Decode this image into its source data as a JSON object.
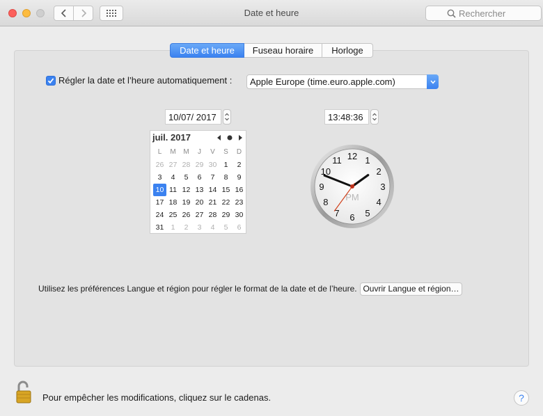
{
  "window": {
    "title": "Date et heure",
    "search_placeholder": "Rechercher"
  },
  "tabs": [
    {
      "label": "Date et heure",
      "active": true
    },
    {
      "label": "Fuseau horaire",
      "active": false
    },
    {
      "label": "Horloge",
      "active": false
    }
  ],
  "auto": {
    "checked": true,
    "label": "Régler la date et l’heure automatiquement :",
    "server": "Apple Europe (time.euro.apple.com)"
  },
  "date_field": "10/07/ 2017",
  "time_field": "13:48:36",
  "calendar": {
    "month": "juil. 2017",
    "weekdays": [
      "L",
      "M",
      "M",
      "J",
      "V",
      "S",
      "D"
    ],
    "weeks": [
      [
        "26",
        "27",
        "28",
        "29",
        "30",
        "1",
        "2"
      ],
      [
        "3",
        "4",
        "5",
        "6",
        "7",
        "8",
        "9"
      ],
      [
        "10",
        "11",
        "12",
        "13",
        "14",
        "15",
        "16"
      ],
      [
        "17",
        "18",
        "19",
        "20",
        "21",
        "22",
        "23"
      ],
      [
        "24",
        "25",
        "26",
        "27",
        "28",
        "29",
        "30"
      ],
      [
        "31",
        "1",
        "2",
        "3",
        "4",
        "5",
        "6"
      ]
    ],
    "selected_day": "10"
  },
  "clock": {
    "numbers": [
      "12",
      "1",
      "2",
      "3",
      "4",
      "5",
      "6",
      "7",
      "8",
      "9",
      "10",
      "11"
    ],
    "ampm": "PM"
  },
  "footer": {
    "info": "Utilisez les préférences Langue et région pour régler le format de la date et de l’heure.",
    "lang_button": "Ouvrir Langue et région…",
    "lock_text": "Pour empêcher les modifications, cliquez sur le cadenas.",
    "help": "?"
  },
  "colors": {
    "accent": "#3b82f0",
    "second_hand": "#d0401b"
  }
}
